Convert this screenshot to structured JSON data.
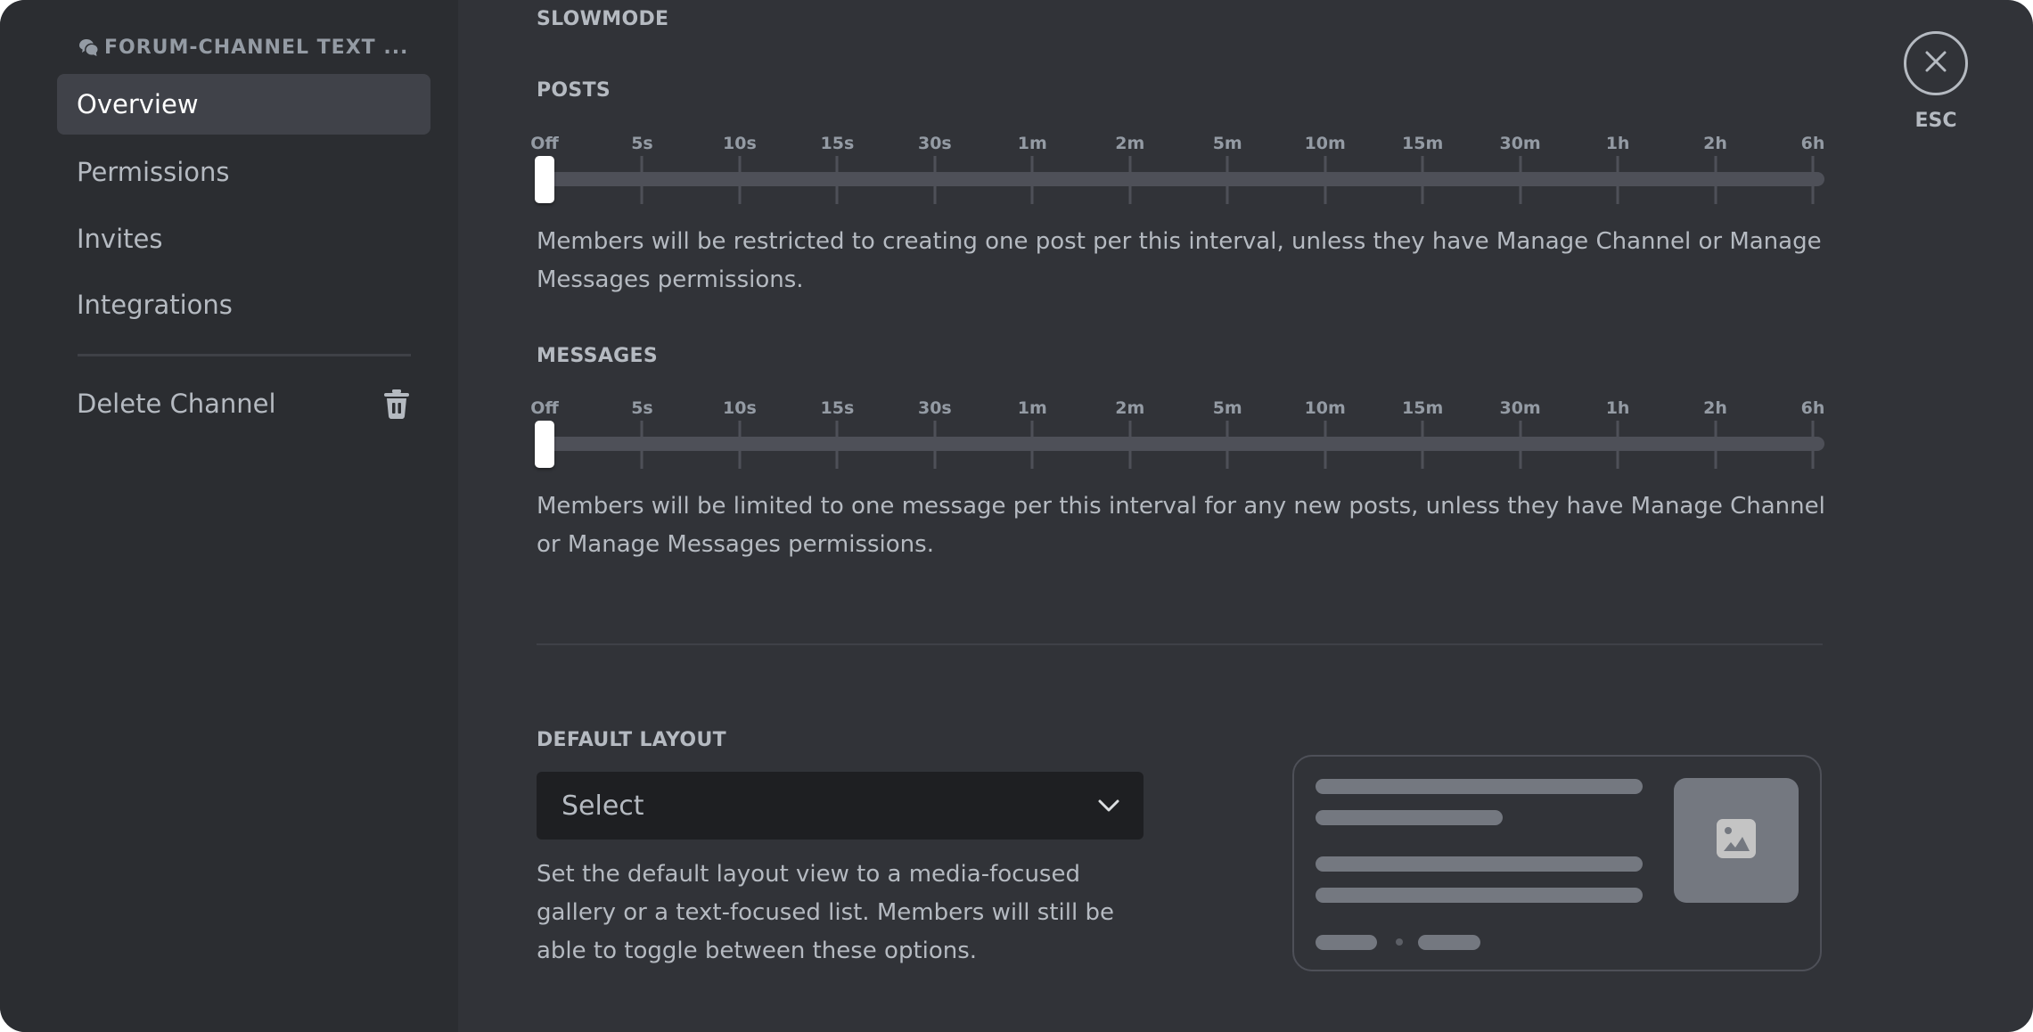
{
  "sidebar": {
    "header": "FORUM-CHANNEL TEXT ...",
    "header_icon": "forum-icon",
    "items": [
      {
        "label": "Overview",
        "active": true
      },
      {
        "label": "Permissions",
        "active": false
      },
      {
        "label": "Invites",
        "active": false
      },
      {
        "label": "Integrations",
        "active": false
      }
    ],
    "delete": {
      "label": "Delete Channel",
      "icon": "trash-icon"
    }
  },
  "close": {
    "icon": "close-icon",
    "label": "ESC"
  },
  "slowmode": {
    "title": "SLOWMODE",
    "ticks": [
      "Off",
      "5s",
      "10s",
      "15s",
      "30s",
      "1m",
      "2m",
      "5m",
      "10m",
      "15m",
      "30m",
      "1h",
      "2h",
      "6h"
    ],
    "posts": {
      "label": "POSTS",
      "value": "Off",
      "value_index": 0,
      "description": "Members will be restricted to creating one post per this interval, unless they have Manage Channel or Manage Messages permissions."
    },
    "messages": {
      "label": "MESSAGES",
      "value": "Off",
      "value_index": 0,
      "description": "Members will be limited to one message per this interval for any new posts, unless they have Manage Channel or Manage Messages permissions."
    }
  },
  "default_layout": {
    "label": "DEFAULT LAYOUT",
    "select_placeholder": "Select",
    "select_icon": "chevron-down-icon",
    "description": "Set the default layout view to a media-focused gallery or a text-focused list. Members will still be able to toggle between these options.",
    "preview_icon": "image-icon"
  },
  "colors": {
    "sidebar_bg": "#2b2d31",
    "main_bg": "#313338",
    "active_item_bg": "#404249",
    "text_muted": "#b5bac1",
    "track": "#4e5058"
  }
}
